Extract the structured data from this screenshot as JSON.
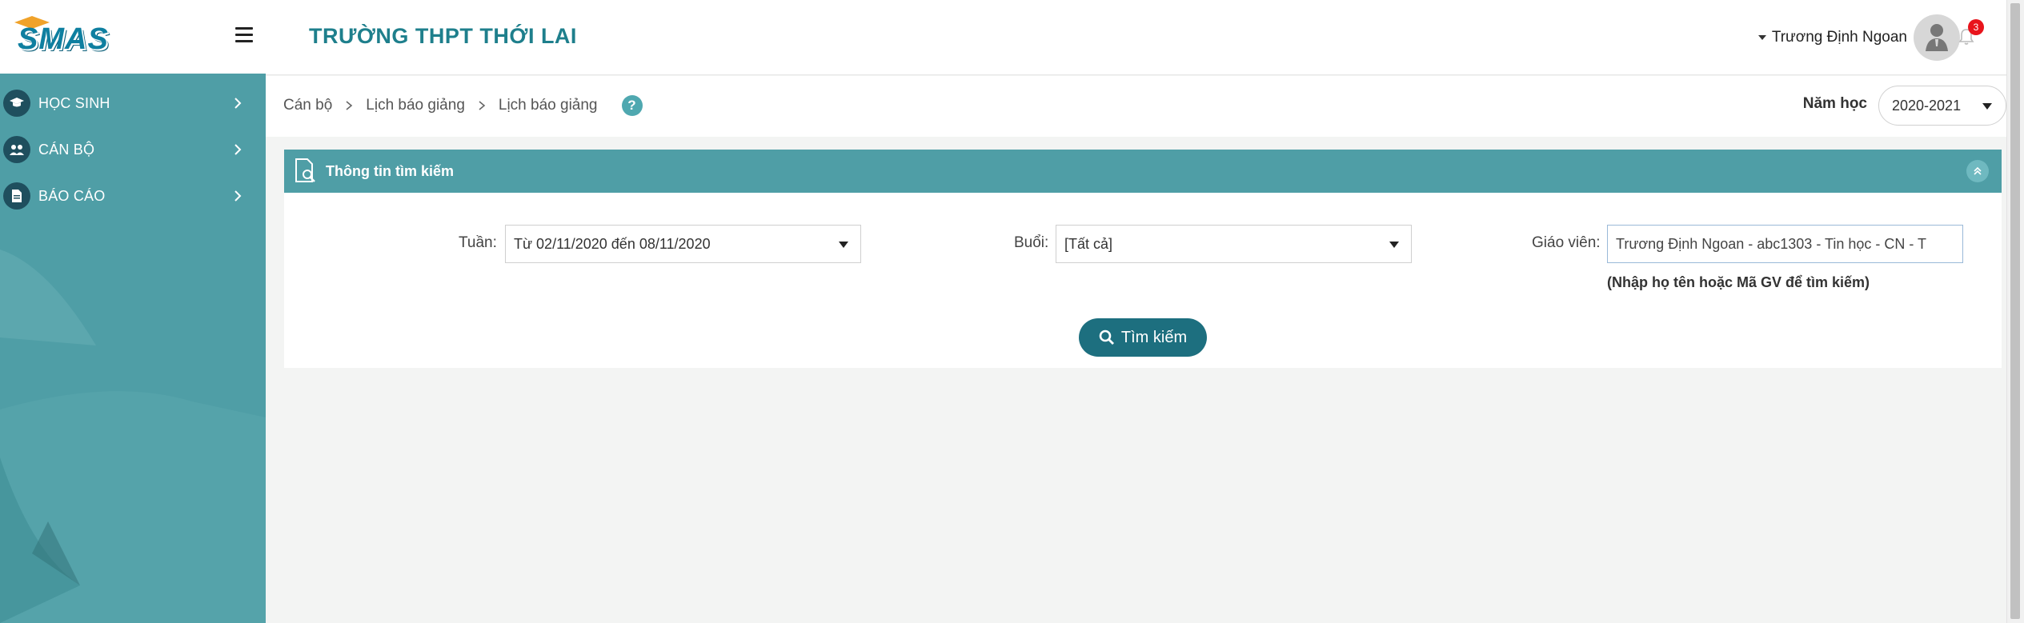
{
  "app": {
    "logo_text": "SMAS",
    "school_title": "TRƯỜNG THPT THỚI LAI"
  },
  "sidebar": {
    "items": [
      {
        "label": "HỌC SINH",
        "icon": "graduation-cap-icon"
      },
      {
        "label": "CÁN BỘ",
        "icon": "users-icon"
      },
      {
        "label": "BÁO CÁO",
        "icon": "document-icon"
      }
    ]
  },
  "user": {
    "name": "Trương Định Ngoan",
    "notification_count": "3"
  },
  "breadcrumb": {
    "items": [
      "Cán bộ",
      "Lịch báo giảng",
      "Lịch báo giảng"
    ],
    "help": "?"
  },
  "school_year": {
    "label": "Năm học",
    "selected": "2020-2021"
  },
  "search_panel": {
    "title": "Thông tin tìm kiếm",
    "week": {
      "label": "Tuần:",
      "selected": "Từ 02/11/2020 đến 08/11/2020"
    },
    "session": {
      "label": "Buổi:",
      "selected": "[Tất cả]"
    },
    "teacher": {
      "label": "Giáo viên:",
      "value": "Trương Định Ngoan - abc1303 - Tin học - CN - T",
      "hint": "(Nhập họ tên hoặc Mã GV để tìm kiếm)"
    },
    "search_button": "Tìm kiếm"
  },
  "colors": {
    "primary": "#4f9ea6",
    "title": "#1e7f8c",
    "button": "#1d6f7f",
    "badge": "#e8141c"
  }
}
